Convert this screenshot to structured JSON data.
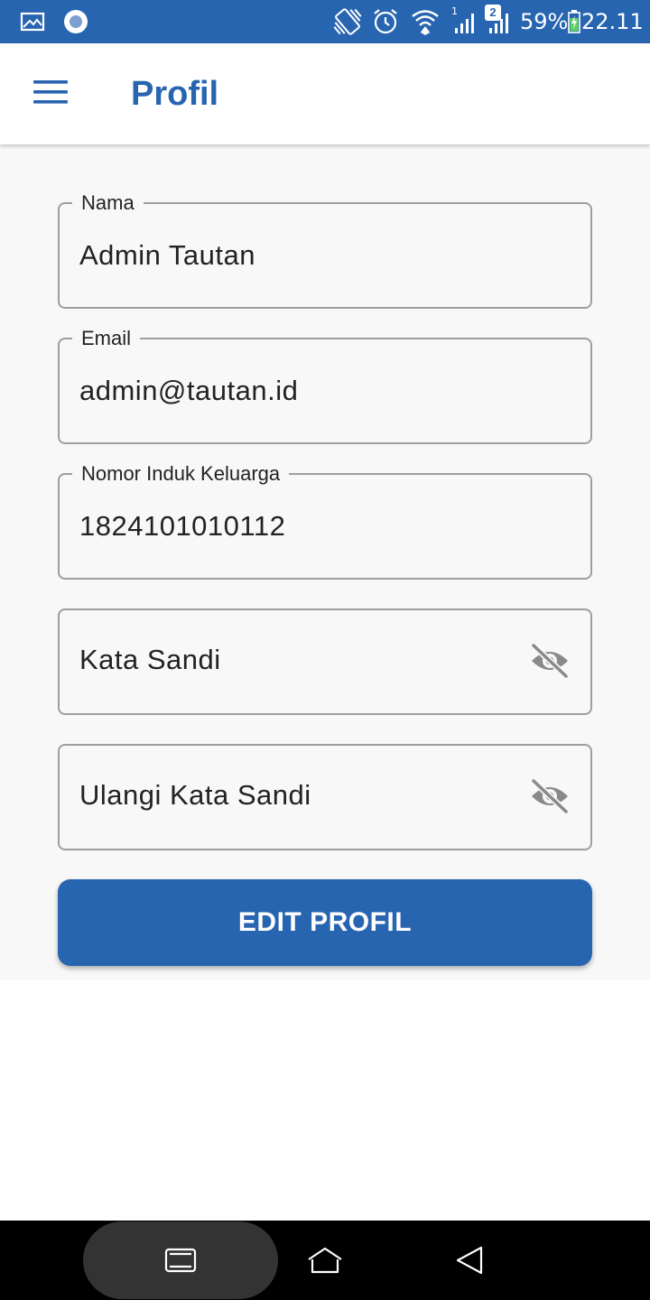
{
  "status_bar": {
    "battery": "59%",
    "time": "22.11",
    "sim1_badge": "1",
    "sim2_badge": "2",
    "icons": [
      "gallery-icon",
      "record-icon",
      "vibrate-icon",
      "alarm-icon",
      "wifi-icon",
      "signal-icon",
      "signal-icon",
      "battery-charging-icon"
    ]
  },
  "app_bar": {
    "title": "Profil",
    "menu_icon": "menu-icon"
  },
  "form": {
    "name": {
      "label": "Nama",
      "value": "Admin Tautan"
    },
    "email": {
      "label": "Email",
      "value": "admin@tautan.id"
    },
    "nik": {
      "label": "Nomor Induk Keluarga",
      "value": "1824101010112"
    },
    "password": {
      "placeholder": "Kata Sandi",
      "icon": "eye-off-icon"
    },
    "password_repeat": {
      "placeholder": "Ulangi Kata Sandi",
      "icon": "eye-off-icon"
    },
    "submit_label": "EDIT PROFIL"
  },
  "nav_bar": {
    "buttons": [
      "recents-icon",
      "home-icon",
      "back-icon"
    ]
  },
  "colors": {
    "primary": "#2865b0",
    "background": "#f8f8f8",
    "border": "#9e9e9e",
    "icon_muted": "#8a8a8a"
  }
}
